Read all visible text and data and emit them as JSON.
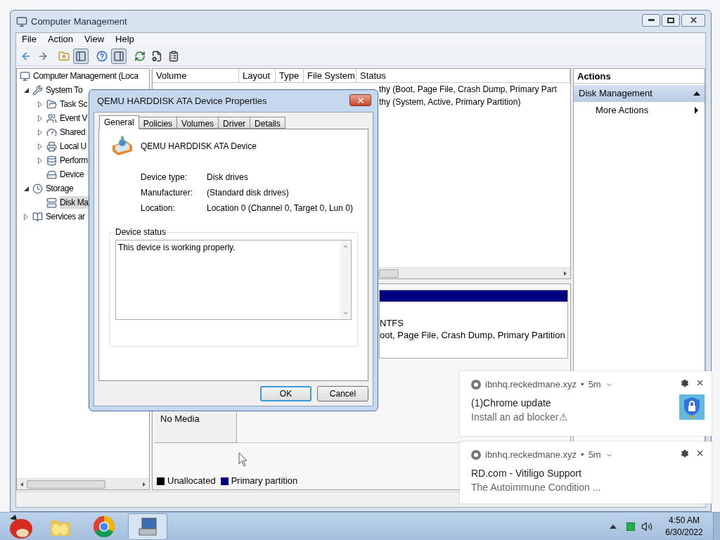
{
  "window": {
    "title": "Computer Management"
  },
  "menu": [
    "File",
    "Action",
    "View",
    "Help"
  ],
  "toolbar": [
    {
      "pressed": false
    },
    {
      "pressed": false
    },
    {
      "pressed": false
    },
    {
      "pressed": true
    },
    {
      "pressed": false
    },
    {
      "pressed": true
    },
    {
      "pressed": false
    },
    {
      "pressed": false
    },
    {
      "pressed": false
    }
  ],
  "tree": [
    {
      "label": "Computer Management (Loca",
      "selected": false,
      "children": [
        {
          "label": "System To",
          "expanded": true,
          "selected": false,
          "children": [
            {
              "label": "Task Sc",
              "expanded": false,
              "selected": false
            },
            {
              "label": "Event V",
              "expanded": false,
              "selected": false
            },
            {
              "label": "Shared",
              "expanded": false,
              "selected": false
            },
            {
              "label": "Local U",
              "expanded": false,
              "selected": false
            },
            {
              "label": "Perform",
              "expanded": false,
              "selected": false
            },
            {
              "label": "Device",
              "selected": false
            }
          ]
        },
        {
          "label": "Storage",
          "expanded": true,
          "selected": false,
          "children": [
            {
              "label": "Disk Ma",
              "selected": true
            }
          ]
        },
        {
          "label": "Services ar",
          "expanded": false,
          "selected": false
        }
      ]
    }
  ],
  "volume_table": {
    "columns": [
      "Volume",
      "Layout",
      "Type",
      "File System",
      "Status"
    ],
    "rows": [
      {
        "status": "thy (Boot, Page File, Crash Dump, Primary Part"
      },
      {
        "status": "thy (System, Active, Primary Partition)"
      }
    ]
  },
  "disks": [
    {
      "kind": "partition",
      "color": "#000080",
      "lines": [
        "NTFS",
        "oot, Page File, Crash Dump, Primary Partition"
      ]
    },
    {
      "kind": "empty",
      "label": "No Media"
    }
  ],
  "legend": [
    {
      "label": "Unallocated",
      "color": "#000000"
    },
    {
      "label": "Primary partition",
      "color": "#000080"
    }
  ],
  "actions": {
    "title": "Actions",
    "sections": [
      {
        "label": "Disk Management",
        "expanded": true,
        "items": [
          "More Actions"
        ]
      }
    ]
  },
  "dialog": {
    "title": "QEMU HARDDISK ATA Device Properties",
    "tabs": [
      {
        "label": "General",
        "selected": true
      },
      {
        "label": "Policies",
        "selected": false
      },
      {
        "label": "Volumes",
        "selected": false
      },
      {
        "label": "Driver",
        "selected": false
      },
      {
        "label": "Details",
        "selected": false
      }
    ],
    "device_name": "QEMU HARDDISK ATA Device",
    "properties": [
      {
        "label": "Device type:",
        "value": "Disk drives"
      },
      {
        "label": "Manufacturer:",
        "value": "(Standard disk drives)"
      },
      {
        "label": "Location:",
        "value": "Location 0 (Channel 0, Target 0, Lun 0)"
      }
    ],
    "status_group": "Device status",
    "status_text": "This device is working properly.",
    "buttons": [
      {
        "label": "OK",
        "default": true
      },
      {
        "label": "Cancel",
        "default": false
      }
    ]
  },
  "notifications": [
    {
      "source": "ibnhq.reckedmane.xyz",
      "separator": "•",
      "time": "5m",
      "title": "(1)Chrome update",
      "body": "Install an ad blocker⚠",
      "image": true
    },
    {
      "source": "ibnhq.reckedmane.xyz",
      "separator": "•",
      "time": "5m",
      "title": "RD.com - Vitiligo Support",
      "body": "The Autoimmune Condition ...",
      "image": false
    }
  ],
  "taskbar": {
    "apps": [
      {
        "selected": false
      },
      {
        "selected": false
      },
      {
        "selected": false
      },
      {
        "selected": true
      }
    ],
    "time": "4:50 AM",
    "date": "6/30/2022"
  }
}
